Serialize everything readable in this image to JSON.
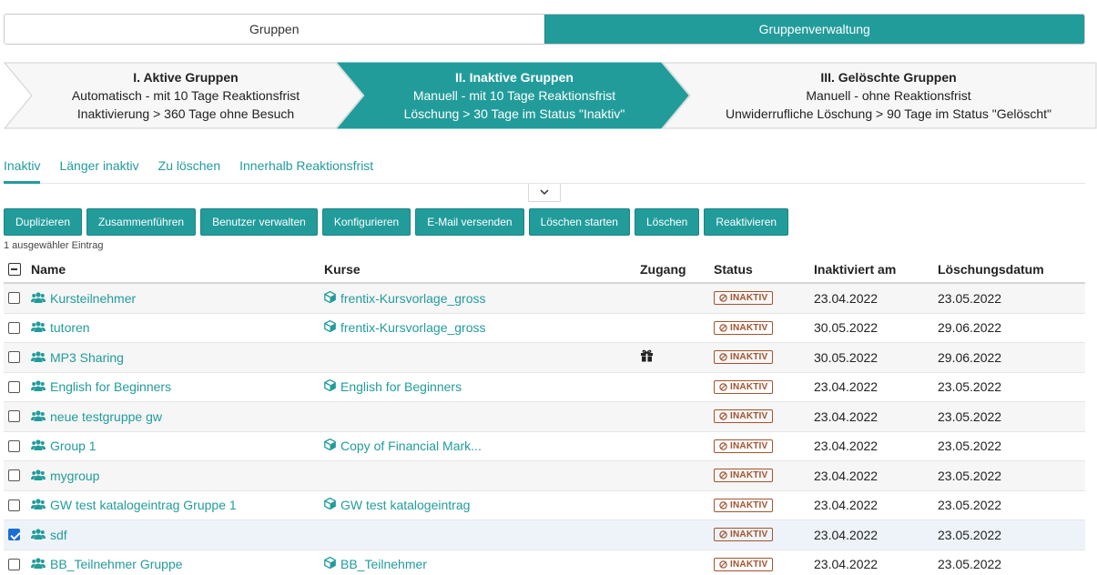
{
  "top_tabs": [
    {
      "label": "Gruppen",
      "active": false
    },
    {
      "label": "Gruppenverwaltung",
      "active": true
    }
  ],
  "steps": [
    {
      "title": "I. Aktive Gruppen",
      "line1": "Automatisch - mit 10 Tage Reaktionsfrist",
      "line2": "Inaktivierung > 360 Tage ohne Besuch"
    },
    {
      "title": "II. Inaktive Gruppen",
      "line1": "Manuell - mit 10 Tage Reaktionsfrist",
      "line2": "Löschung > 30 Tage im Status \"Inaktiv\""
    },
    {
      "title": "III. Gelöschte Gruppen",
      "line1": "Manuell - ohne Reaktionsfrist",
      "line2": "Unwiderrufliche Löschung > 90 Tage im Status \"Gelöscht\""
    }
  ],
  "sub_tabs": [
    "Inaktiv",
    "Länger inaktiv",
    "Zu löschen",
    "Innerhalb Reaktionsfrist"
  ],
  "actions": [
    "Duplizieren",
    "Zusammenführen",
    "Benutzer verwalten",
    "Konfigurieren",
    "E-Mail versenden",
    "Löschen starten",
    "Löschen",
    "Reaktivieren"
  ],
  "selection_info": "1 ausgewähler Eintrag",
  "columns": {
    "name": "Name",
    "kurse": "Kurse",
    "zugang": "Zugang",
    "status": "Status",
    "inaktiviert": "Inaktiviert am",
    "loeschung": "Löschungsdatum"
  },
  "status_label": "INAKTIV",
  "rows": [
    {
      "name": "Kursteilnehmer",
      "kurse": "frentix-Kursvorlage_gross",
      "zugang": "",
      "inaktiviert": "23.04.2022",
      "loeschung": "23.05.2022",
      "checked": false
    },
    {
      "name": "tutoren",
      "kurse": "frentix-Kursvorlage_gross",
      "zugang": "",
      "inaktiviert": "30.05.2022",
      "loeschung": "29.06.2022",
      "checked": false
    },
    {
      "name": "MP3 Sharing",
      "kurse": "",
      "zugang": "gift-icon",
      "inaktiviert": "30.05.2022",
      "loeschung": "29.06.2022",
      "checked": false
    },
    {
      "name": "English for Beginners",
      "kurse": "English for Beginners",
      "zugang": "",
      "inaktiviert": "23.04.2022",
      "loeschung": "23.05.2022",
      "checked": false
    },
    {
      "name": "neue testgruppe gw",
      "kurse": "",
      "zugang": "",
      "inaktiviert": "23.04.2022",
      "loeschung": "23.05.2022",
      "checked": false
    },
    {
      "name": "Group 1",
      "kurse": "Copy of Financial Mark...",
      "zugang": "",
      "inaktiviert": "23.04.2022",
      "loeschung": "23.05.2022",
      "checked": false
    },
    {
      "name": "mygroup",
      "kurse": "",
      "zugang": "",
      "inaktiviert": "23.04.2022",
      "loeschung": "23.05.2022",
      "checked": false
    },
    {
      "name": "GW test katalogeintrag Gruppe 1",
      "kurse": "GW test katalogeintrag",
      "zugang": "",
      "inaktiviert": "23.04.2022",
      "loeschung": "23.05.2022",
      "checked": false
    },
    {
      "name": "sdf",
      "kurse": "",
      "zugang": "",
      "inaktiviert": "23.04.2022",
      "loeschung": "23.05.2022",
      "checked": true
    },
    {
      "name": "BB_Teilnehmer Gruppe",
      "kurse": "BB_Teilnehmer",
      "zugang": "",
      "inaktiviert": "23.04.2022",
      "loeschung": "23.05.2022",
      "checked": false
    }
  ],
  "colors": {
    "accent": "#229c9b",
    "status": "#a3532f",
    "checkbox": "#1a6fd6"
  }
}
